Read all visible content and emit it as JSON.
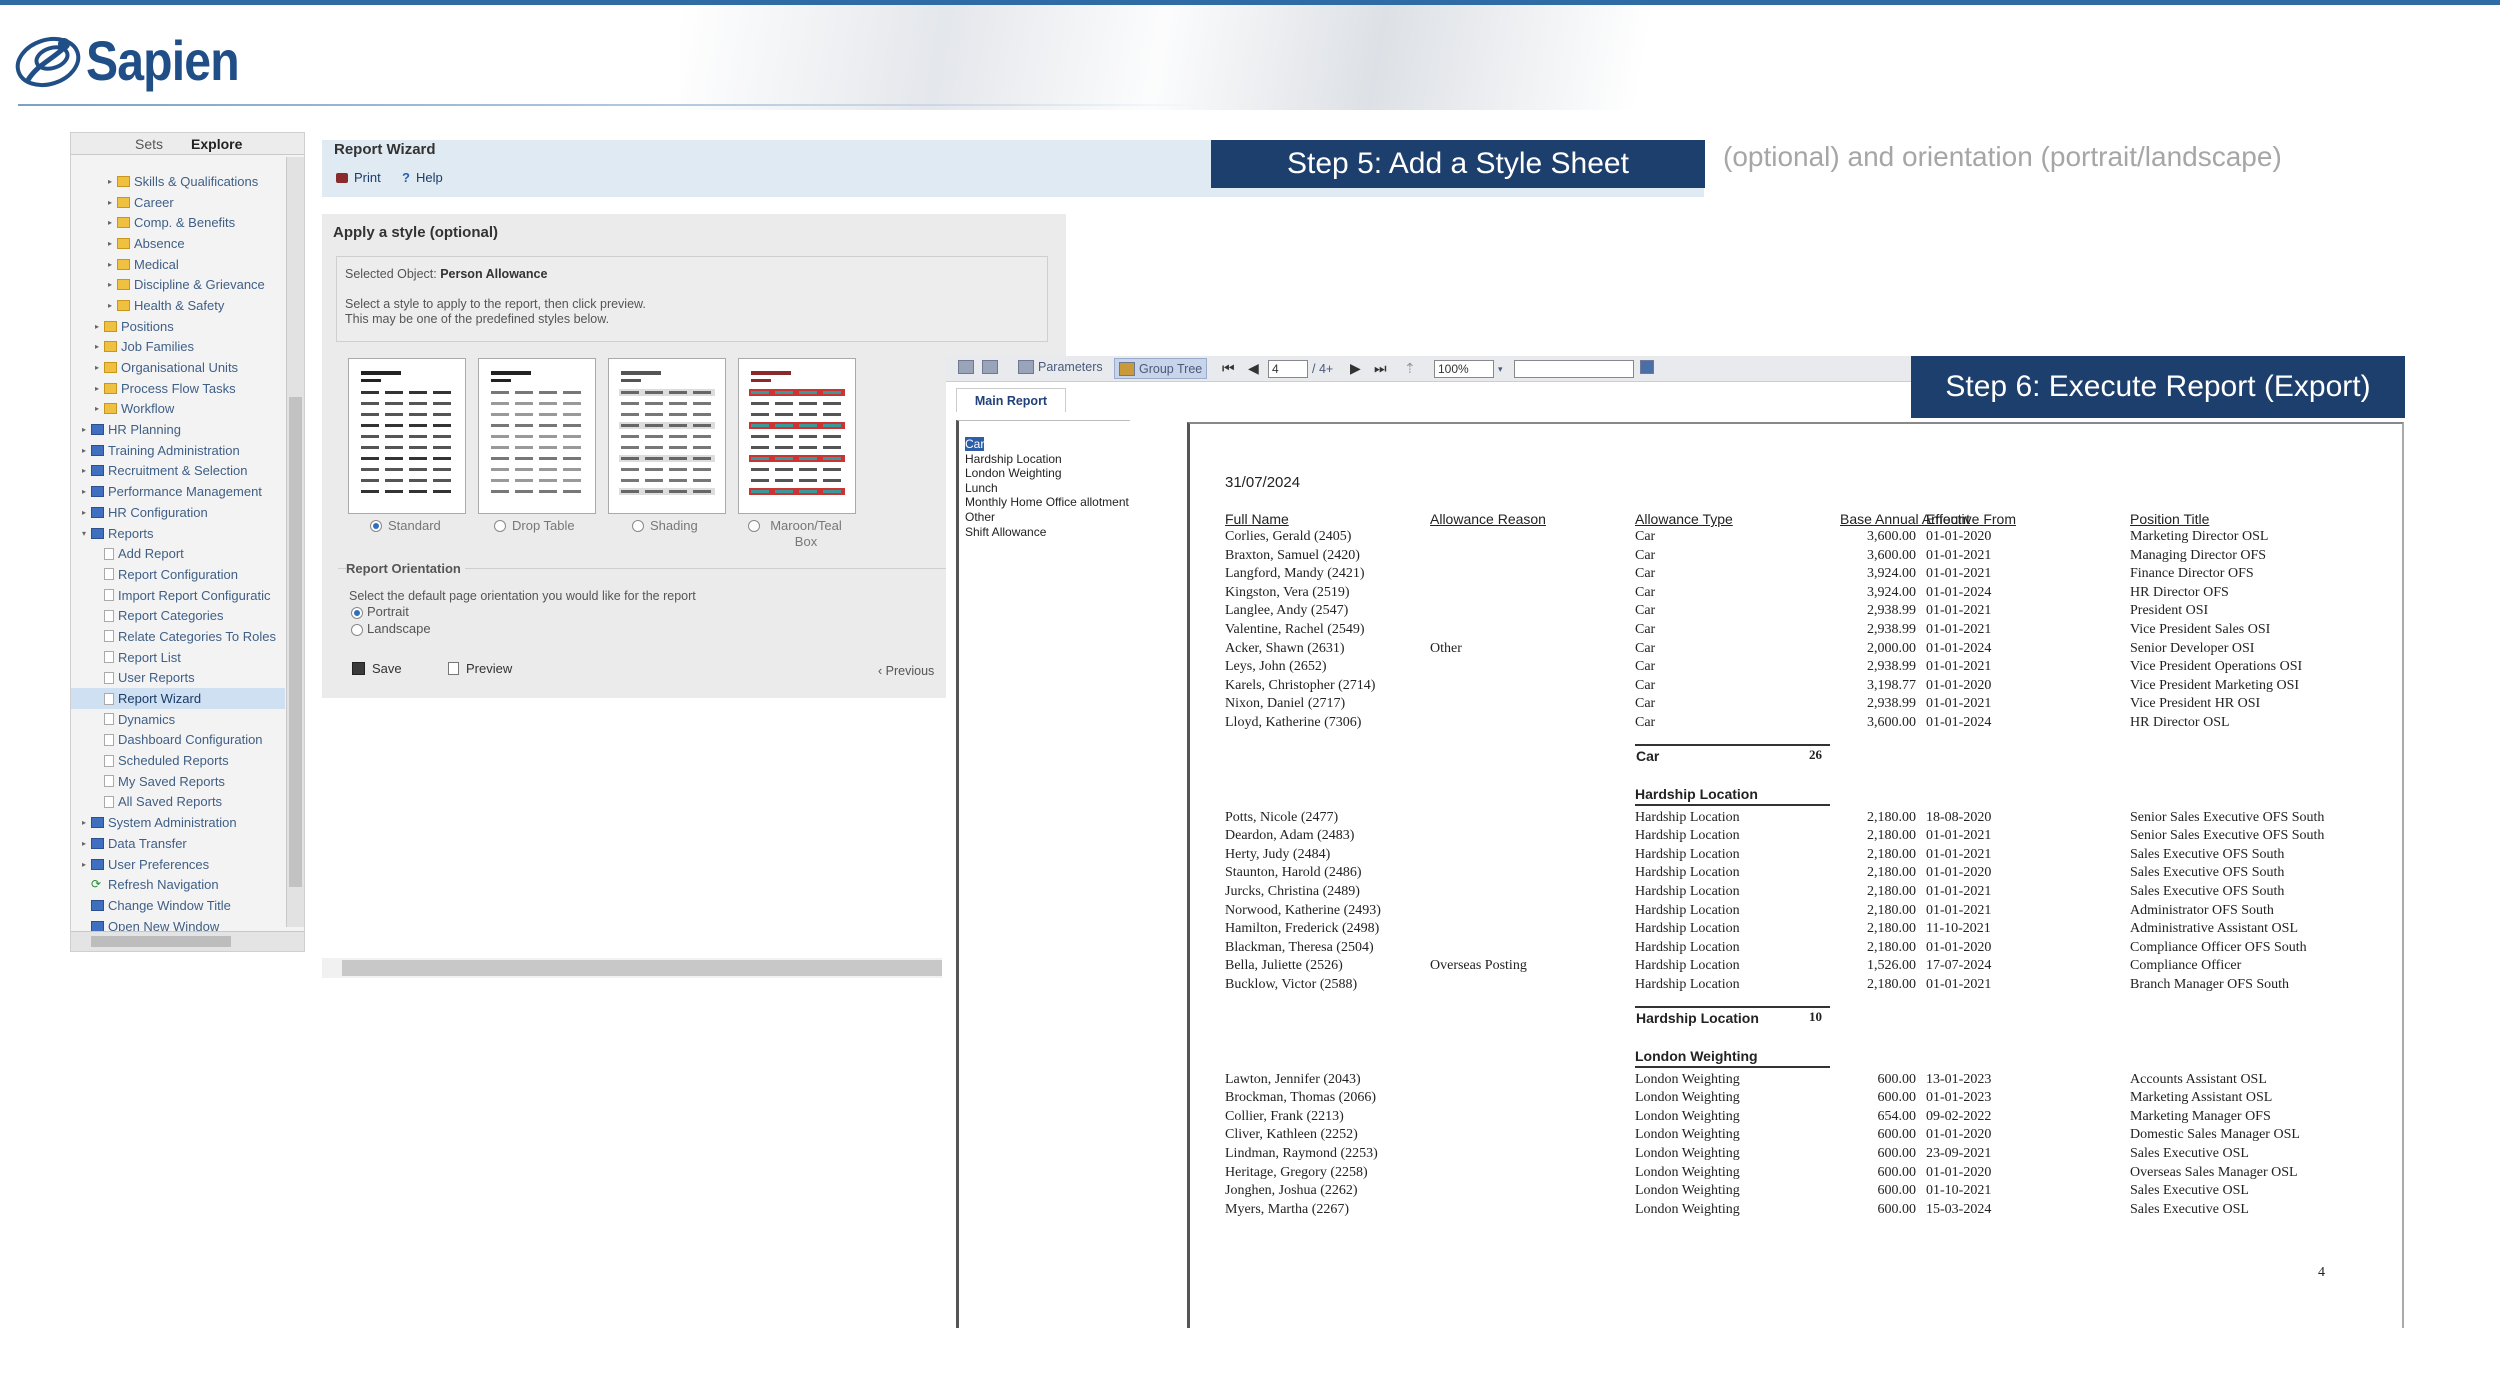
{
  "logo": {
    "text": "Sapien"
  },
  "nav": {
    "tabs": [
      "Sets",
      "Explore"
    ],
    "items": [
      {
        "label": "Skills & Qualifications",
        "indent": 2,
        "icon": "folder",
        "arrow": "▸"
      },
      {
        "label": "Career",
        "indent": 2,
        "icon": "folder",
        "arrow": "▸"
      },
      {
        "label": "Comp. & Benefits",
        "indent": 2,
        "icon": "folder",
        "arrow": "▸"
      },
      {
        "label": "Absence",
        "indent": 2,
        "icon": "folder",
        "arrow": "▸"
      },
      {
        "label": "Medical",
        "indent": 2,
        "icon": "folder",
        "arrow": "▸"
      },
      {
        "label": "Discipline & Grievance",
        "indent": 2,
        "icon": "folder",
        "arrow": "▸"
      },
      {
        "label": "Health & Safety",
        "indent": 2,
        "icon": "folder",
        "arrow": "▸"
      },
      {
        "label": "Positions",
        "indent": 1,
        "icon": "folder",
        "arrow": "▸"
      },
      {
        "label": "Job Families",
        "indent": 1,
        "icon": "folder",
        "arrow": "▸"
      },
      {
        "label": "Organisational Units",
        "indent": 1,
        "icon": "folder",
        "arrow": "▸"
      },
      {
        "label": "Process Flow Tasks",
        "indent": 1,
        "icon": "folder",
        "arrow": "▸"
      },
      {
        "label": "Workflow",
        "indent": 1,
        "icon": "folder",
        "arrow": "▸"
      },
      {
        "label": "HR Planning",
        "indent": 0,
        "icon": "blue",
        "arrow": "▸"
      },
      {
        "label": "Training Administration",
        "indent": 0,
        "icon": "blue",
        "arrow": "▸"
      },
      {
        "label": "Recruitment & Selection",
        "indent": 0,
        "icon": "blue",
        "arrow": "▸"
      },
      {
        "label": "Performance Management",
        "indent": 0,
        "icon": "blue",
        "arrow": "▸"
      },
      {
        "label": "HR Configuration",
        "indent": 0,
        "icon": "blue",
        "arrow": "▸"
      },
      {
        "label": "Reports",
        "indent": 0,
        "icon": "blue",
        "arrow": "▾"
      },
      {
        "label": "Add Report",
        "indent": 1,
        "icon": "page",
        "arrow": ""
      },
      {
        "label": "Report Configuration",
        "indent": 1,
        "icon": "page",
        "arrow": ""
      },
      {
        "label": "Import Report Configuratic",
        "indent": 1,
        "icon": "page",
        "arrow": ""
      },
      {
        "label": "Report Categories",
        "indent": 1,
        "icon": "page",
        "arrow": ""
      },
      {
        "label": "Relate Categories To Roles",
        "indent": 1,
        "icon": "page",
        "arrow": ""
      },
      {
        "label": "Report List",
        "indent": 1,
        "icon": "page",
        "arrow": ""
      },
      {
        "label": "User Reports",
        "indent": 1,
        "icon": "page",
        "arrow": ""
      },
      {
        "label": "Report Wizard",
        "indent": 1,
        "icon": "page",
        "arrow": "",
        "selected": true
      },
      {
        "label": "Dynamics",
        "indent": 1,
        "icon": "page",
        "arrow": ""
      },
      {
        "label": "Dashboard Configuration",
        "indent": 1,
        "icon": "page",
        "arrow": ""
      },
      {
        "label": "Scheduled Reports",
        "indent": 1,
        "icon": "page",
        "arrow": ""
      },
      {
        "label": "My Saved Reports",
        "indent": 1,
        "icon": "page",
        "arrow": ""
      },
      {
        "label": "All Saved Reports",
        "indent": 1,
        "icon": "page",
        "arrow": ""
      },
      {
        "label": "System Administration",
        "indent": 0,
        "icon": "blue",
        "arrow": "▸"
      },
      {
        "label": "Data Transfer",
        "indent": 0,
        "icon": "blue",
        "arrow": "▸"
      },
      {
        "label": "User Preferences",
        "indent": 0,
        "icon": "blue",
        "arrow": "▸"
      },
      {
        "label": "Refresh Navigation",
        "indent": 0,
        "icon": "refresh",
        "arrow": ""
      },
      {
        "label": "Change Window Title",
        "indent": 0,
        "icon": "blue",
        "arrow": ""
      },
      {
        "label": "Open New Window",
        "indent": 0,
        "icon": "blue",
        "arrow": ""
      }
    ]
  },
  "wizard": {
    "title": "Report Wizard",
    "print_label": "Print",
    "help_label": "Help",
    "apply_title": "Apply a style (optional)",
    "selected_object_label": "Selected Object:",
    "selected_object_value": "Person Allowance",
    "desc_line1": "Select a style to apply to the report, then click preview.",
    "desc_line2": "This may be one of the predefined styles below.",
    "styles": [
      {
        "label": "Standard",
        "selected": true
      },
      {
        "label": "Drop Table",
        "selected": false
      },
      {
        "label": "Shading",
        "selected": false
      },
      {
        "label": "Maroon/Teal Box",
        "selected": false
      }
    ],
    "orientation_title": "Report Orientation",
    "orientation_desc": "Select the default page orientation you would like for the report",
    "portrait_label": "Portrait",
    "landscape_label": "Landscape",
    "orientation_selected": "Portrait",
    "save_label": "Save",
    "preview_label": "Preview",
    "previous_label": "‹ Previous"
  },
  "banners": {
    "step5": "Step 5: Add a Style Sheet",
    "step5_note": "(optional) and orientation (portrait/landscape)",
    "step6": "Step 6: Execute Report (Export)"
  },
  "viewer": {
    "parameters_label": "Parameters",
    "group_tree_label": "Group Tree",
    "page_value": "4",
    "page_total": "/ 4+",
    "zoom_value": "100%",
    "main_tab": "Main Report",
    "tree_items": [
      "Car",
      "Hardship Location",
      "London Weighting",
      "Lunch",
      "Monthly Home Office allotment",
      "Other",
      "Shift Allowance"
    ],
    "tree_selected": "Car"
  },
  "report": {
    "date": "31/07/2024",
    "headers": {
      "name": "Full Name",
      "reason": "Allowance Reason",
      "type": "Allowance Type",
      "amount": "Base Annual Amount",
      "effective": "Effective From",
      "position": "Position Title"
    },
    "groups": [
      {
        "name": "Car",
        "show_header": false,
        "total": "26",
        "rows": [
          [
            "Corlies, Gerald (2405)",
            "",
            "Car",
            "3,600.00",
            "01-01-2020",
            "Marketing Director OSL"
          ],
          [
            "Braxton, Samuel (2420)",
            "",
            "Car",
            "3,600.00",
            "01-01-2021",
            "Managing Director OFS"
          ],
          [
            "Langford, Mandy (2421)",
            "",
            "Car",
            "3,924.00",
            "01-01-2021",
            "Finance Director OFS"
          ],
          [
            "Kingston, Vera (2519)",
            "",
            "Car",
            "3,924.00",
            "01-01-2024",
            "HR Director OFS"
          ],
          [
            "Langlee, Andy (2547)",
            "",
            "Car",
            "2,938.99",
            "01-01-2021",
            "President OSI"
          ],
          [
            "Valentine, Rachel (2549)",
            "",
            "Car",
            "2,938.99",
            "01-01-2021",
            "Vice President Sales OSI"
          ],
          [
            "Acker, Shawn (2631)",
            "Other",
            "Car",
            "2,000.00",
            "01-01-2024",
            "Senior Developer OSI"
          ],
          [
            "Leys, John (2652)",
            "",
            "Car",
            "2,938.99",
            "01-01-2021",
            "Vice President Operations OSI"
          ],
          [
            "Karels, Christopher (2714)",
            "",
            "Car",
            "3,198.77",
            "01-01-2020",
            "Vice President Marketing OSI"
          ],
          [
            "Nixon, Daniel (2717)",
            "",
            "Car",
            "2,938.99",
            "01-01-2021",
            "Vice President HR OSI"
          ],
          [
            "Lloyd, Katherine (7306)",
            "",
            "Car",
            "3,600.00",
            "01-01-2024",
            "HR Director OSL"
          ]
        ]
      },
      {
        "name": "Hardship Location",
        "show_header": true,
        "total": "10",
        "rows": [
          [
            "Potts, Nicole (2477)",
            "",
            "Hardship Location",
            "2,180.00",
            "18-08-2020",
            "Senior Sales Executive OFS South"
          ],
          [
            "Deardon, Adam (2483)",
            "",
            "Hardship Location",
            "2,180.00",
            "01-01-2021",
            "Senior Sales Executive OFS South"
          ],
          [
            "Herty, Judy (2484)",
            "",
            "Hardship Location",
            "2,180.00",
            "01-01-2021",
            "Sales Executive OFS South"
          ],
          [
            "Staunton, Harold (2486)",
            "",
            "Hardship Location",
            "2,180.00",
            "01-01-2020",
            "Sales Executive OFS South"
          ],
          [
            "Jurcks, Christina (2489)",
            "",
            "Hardship Location",
            "2,180.00",
            "01-01-2021",
            "Sales Executive OFS South"
          ],
          [
            "Norwood, Katherine (2493)",
            "",
            "Hardship Location",
            "2,180.00",
            "01-01-2021",
            "Administrator OFS South"
          ],
          [
            "Hamilton, Frederick (2498)",
            "",
            "Hardship Location",
            "2,180.00",
            "11-10-2021",
            "Administrative Assistant OSL"
          ],
          [
            "Blackman, Theresa (2504)",
            "",
            "Hardship Location",
            "2,180.00",
            "01-01-2020",
            "Compliance Officer OFS South"
          ],
          [
            "Bella, Juliette (2526)",
            "Overseas Posting",
            "Hardship Location",
            "1,526.00",
            "17-07-2024",
            "Compliance Officer"
          ],
          [
            "Bucklow, Victor (2588)",
            "",
            "Hardship Location",
            "2,180.00",
            "01-01-2021",
            "Branch Manager OFS South"
          ]
        ]
      },
      {
        "name": "London Weighting",
        "show_header": true,
        "total": "",
        "rows": [
          [
            "Lawton, Jennifer (2043)",
            "",
            "London Weighting",
            "600.00",
            "13-01-2023",
            "Accounts Assistant OSL"
          ],
          [
            "Brockman, Thomas (2066)",
            "",
            "London Weighting",
            "600.00",
            "01-01-2023",
            "Marketing Assistant OSL"
          ],
          [
            "Collier, Frank (2213)",
            "",
            "London Weighting",
            "654.00",
            "09-02-2022",
            "Marketing Manager OFS"
          ],
          [
            "Cliver, Kathleen (2252)",
            "",
            "London Weighting",
            "600.00",
            "01-01-2020",
            "Domestic Sales Manager OSL"
          ],
          [
            "Lindman, Raymond (2253)",
            "",
            "London Weighting",
            "600.00",
            "23-09-2021",
            "Sales Executive OSL"
          ],
          [
            "Heritage, Gregory (2258)",
            "",
            "London Weighting",
            "600.00",
            "01-01-2020",
            "Overseas Sales Manager OSL"
          ],
          [
            "Jonghen, Joshua (2262)",
            "",
            "London Weighting",
            "600.00",
            "01-10-2021",
            "Sales Executive OSL"
          ],
          [
            "Myers, Martha (2267)",
            "",
            "London Weighting",
            "600.00",
            "15-03-2024",
            "Sales Executive OSL"
          ]
        ]
      }
    ],
    "page_number": "4"
  }
}
